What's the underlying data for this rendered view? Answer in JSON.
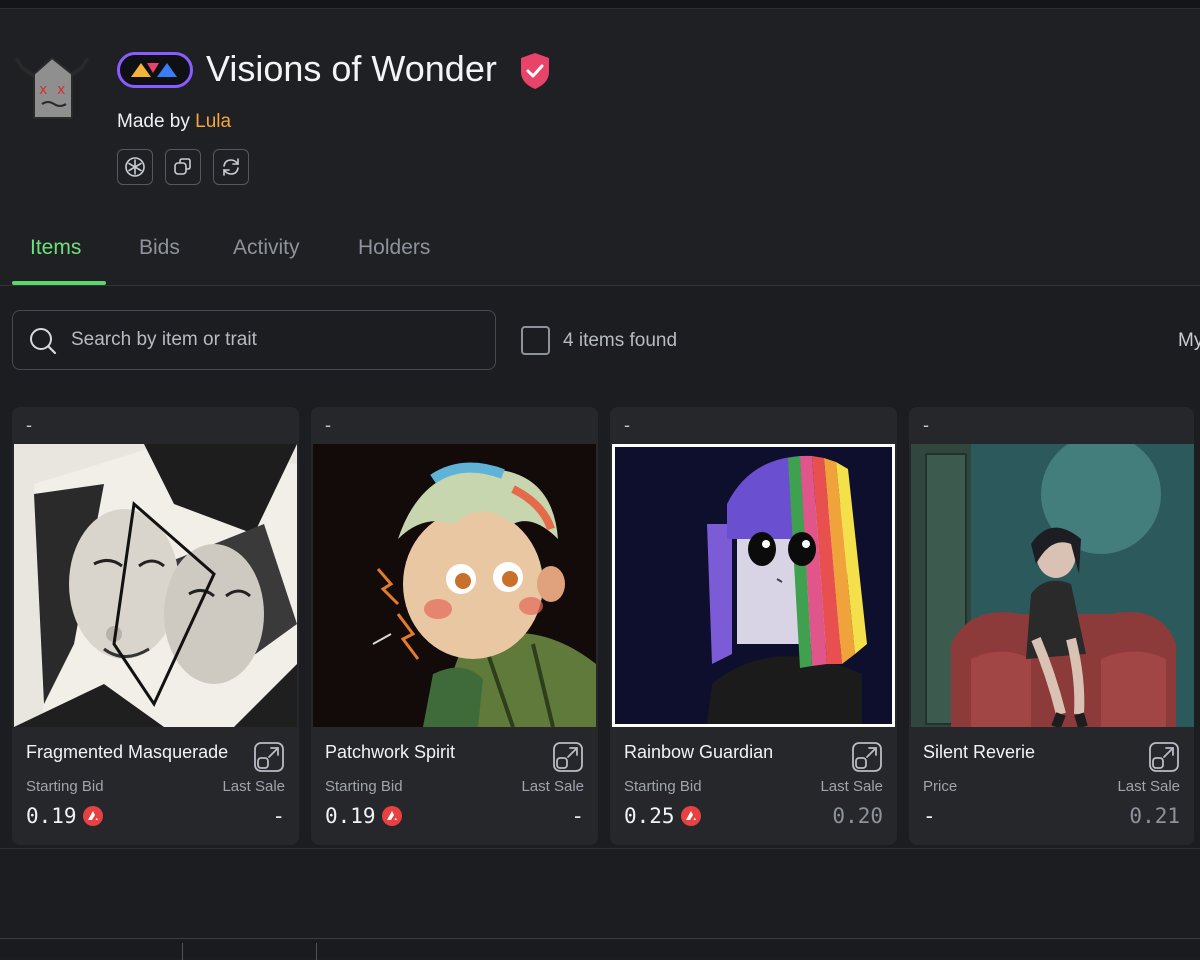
{
  "collection": {
    "title": "Visions of Wonder",
    "made_by_prefix": "Made by",
    "creator": "Lula",
    "icons": [
      "snowflake-icon",
      "copy-icon",
      "refresh-icon"
    ]
  },
  "tabs": [
    {
      "label": "Items",
      "active": true
    },
    {
      "label": "Bids",
      "active": false
    },
    {
      "label": "Activity",
      "active": false
    },
    {
      "label": "Holders",
      "active": false
    }
  ],
  "search": {
    "placeholder": "Search by item or trait"
  },
  "filter": {
    "items_found": "4 items found",
    "my_label": "My"
  },
  "colors": {
    "accent": "#5ed56a",
    "creator": "#f6a53b",
    "verified": "#e8446a",
    "avax": "#e84142"
  },
  "cards": [
    {
      "rank": "-",
      "name": "Fragmented Masquerade",
      "left_label": "Starting Bid",
      "right_label": "Last Sale",
      "price": "0.19",
      "last_sale": "-",
      "image": "fragmented-masquerade-artwork"
    },
    {
      "rank": "-",
      "name": "Patchwork Spirit",
      "left_label": "Starting Bid",
      "right_label": "Last Sale",
      "price": "0.19",
      "last_sale": "-",
      "image": "patchwork-spirit-artwork"
    },
    {
      "rank": "-",
      "name": "Rainbow Guardian",
      "left_label": "Starting Bid",
      "right_label": "Last Sale",
      "price": "0.25",
      "last_sale": "0.20",
      "image": "rainbow-guardian-artwork"
    },
    {
      "rank": "-",
      "name": "Silent Reverie",
      "left_label": "Price",
      "right_label": "Last Sale",
      "price": "-",
      "last_sale": "0.21",
      "image": "silent-reverie-artwork"
    }
  ]
}
